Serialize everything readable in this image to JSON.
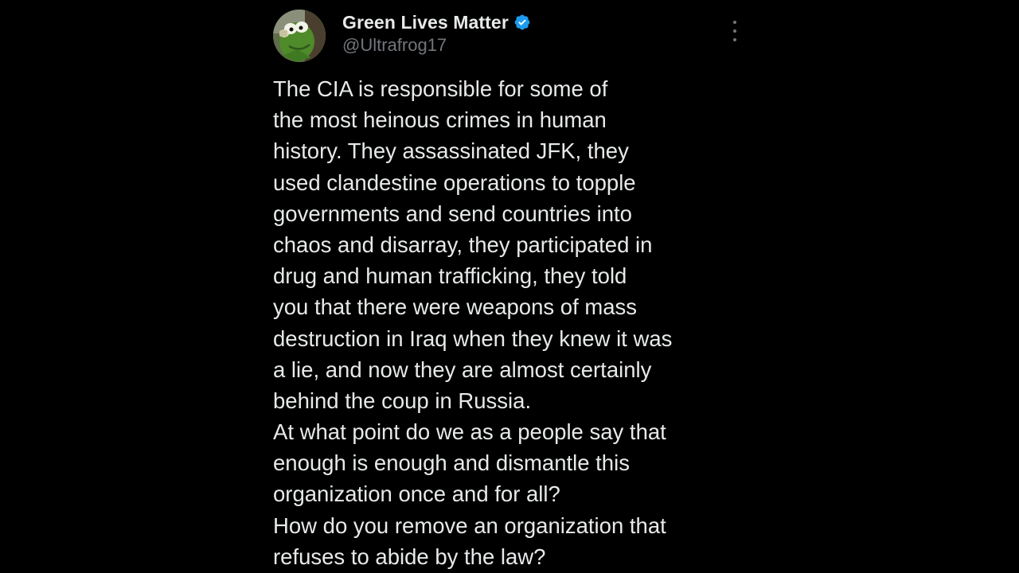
{
  "tweet": {
    "author": {
      "display_name": "Green Lives Matter",
      "handle": "@Ultrafrog17",
      "verified": true,
      "avatar": "kermit-frog-avatar"
    },
    "more_icon": "more-vertical-icon",
    "text_lines": [
      "The CIA is responsible for some of",
      "the most heinous crimes in human",
      "history. They assassinated JFK, they",
      "used clandestine operations to topple",
      "governments and send countries into",
      "chaos and disarray, they participated in",
      "drug and human trafficking, they told",
      "you that there were weapons of mass",
      "destruction in Iraq when they knew it was",
      "a lie, and now they are almost certainly",
      "behind the coup in Russia.",
      "At what point do we as a people say that",
      "enough is enough and dismantle this",
      "organization once and for all?",
      "How do you remove an organization that",
      "refuses to abide by the law?"
    ]
  },
  "colors": {
    "background": "#000000",
    "text": "#e7e9ea",
    "secondary_text": "#71767b",
    "verified_badge": "#1d9bf0"
  }
}
